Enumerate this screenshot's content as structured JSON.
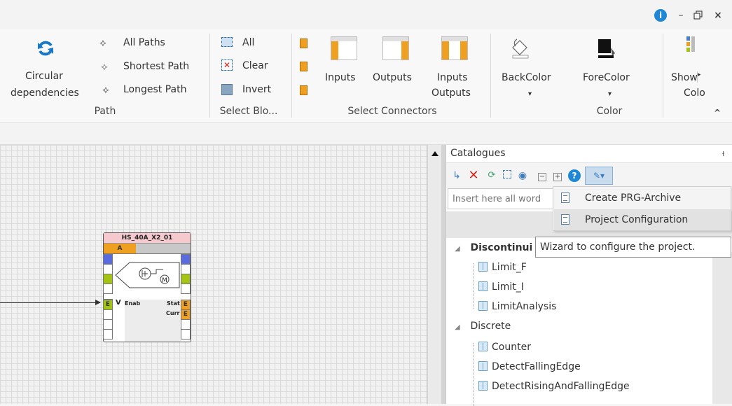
{
  "window": {
    "info_label": "i",
    "minimize_label": "–",
    "restore_label": "🗗",
    "close_label": "×"
  },
  "ribbon": {
    "circular": {
      "line1": "Circular",
      "line2": "dependencies"
    },
    "path_group": {
      "label": "Path",
      "items": [
        "All Paths",
        "Shortest Path",
        "Longest Path"
      ]
    },
    "select_group": {
      "label": "Select Blo...",
      "items": [
        "All",
        "Clear",
        "Invert"
      ]
    },
    "connectors_group": {
      "label": "Select Connectors",
      "inputs": "Inputs",
      "outputs": "Outputs",
      "inputs_outputs_1": "Inputs",
      "inputs_outputs_2": "Outputs"
    },
    "color_group": {
      "label": "Color",
      "backcolor": "BackColor",
      "forecolor": "ForeColor",
      "dropdown_arrow": "▾"
    },
    "show": {
      "line1": "Show",
      "line2": "Colo",
      "overflow": "▸"
    },
    "collapse": "^"
  },
  "catalogues": {
    "title": "Catalogues",
    "pin": "ᵼ",
    "search_placeholder": "Insert here all word",
    "tree": [
      {
        "label": "Discontinui",
        "bold": true,
        "expander": "◢"
      },
      {
        "label": "Limit_F"
      },
      {
        "label": "Limit_I"
      },
      {
        "label": "LimitAnalysis"
      },
      {
        "label": "Discrete",
        "expander": "◢"
      },
      {
        "label": "Counter"
      },
      {
        "label": "DetectFallingEdge"
      },
      {
        "label": "DetectRisingAndFallingEdge"
      }
    ]
  },
  "dropdown": {
    "items": [
      "Create PRG-Archive",
      "Project Configuration"
    ]
  },
  "tooltip": {
    "text": "Wizard to configure the project."
  },
  "block": {
    "title": "HS_40A_X2_01",
    "header_port": "A",
    "input_port": "E",
    "v_label": "V",
    "enab_label": "Enab",
    "stat_label": "Stat",
    "curr_label": "Curr",
    "out_port_1": "E",
    "out_port_2": "E",
    "motor_label": "M"
  },
  "colors": {
    "accent_blue": "#1e88d6",
    "delete_red": "#d9251c",
    "block_title_bg": "#f6c9ce",
    "port_orange": "#f0a020",
    "port_blue": "#5a6be0",
    "port_green": "#a4c414",
    "port_grey": "#c8c8c8"
  }
}
